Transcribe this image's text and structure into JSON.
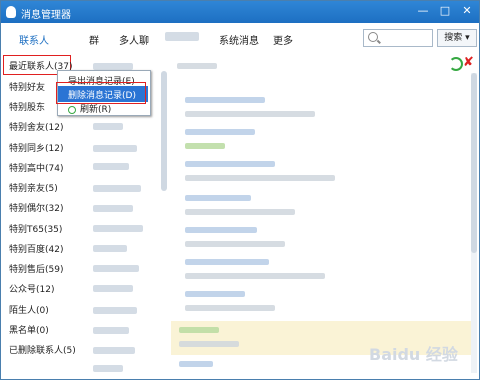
{
  "window": {
    "title": "消息管理器"
  },
  "tabs": [
    {
      "label": "联系人"
    },
    {
      "label": "群"
    },
    {
      "label": "多人聊"
    },
    {
      "label": ""
    },
    {
      "label": "系统消息"
    },
    {
      "label": "更多"
    }
  ],
  "search": {
    "placeholder": "",
    "button_label": "搜索"
  },
  "sidebar": {
    "items": [
      {
        "label": "最近联系人(37)"
      },
      {
        "label": "特别好友"
      },
      {
        "label": "特别股东"
      },
      {
        "label": "特别舍友(12)"
      },
      {
        "label": "特别同乡(12)"
      },
      {
        "label": "特别高中(74)"
      },
      {
        "label": "特别亲友(5)"
      },
      {
        "label": "特别偶尔(32)"
      },
      {
        "label": "特别T65(35)"
      },
      {
        "label": "特别百度(42)"
      },
      {
        "label": "特别售后(59)"
      },
      {
        "label": "公众号(12)"
      },
      {
        "label": "陌生人(0)"
      },
      {
        "label": "黑名单(0)"
      },
      {
        "label": "已删除联系人(5)"
      }
    ]
  },
  "context_menu": {
    "items": [
      {
        "label": "导出消息记录(E)",
        "selected": false
      },
      {
        "label": "删除消息记录(D)",
        "selected": true
      },
      {
        "label": "刷新(R)",
        "selected": false
      }
    ]
  },
  "watermark": "Baidu 经验",
  "colors": {
    "title_bar": "#1d6fc2",
    "highlight_border": "#e02020",
    "menu_selected": "#2a74d4"
  }
}
